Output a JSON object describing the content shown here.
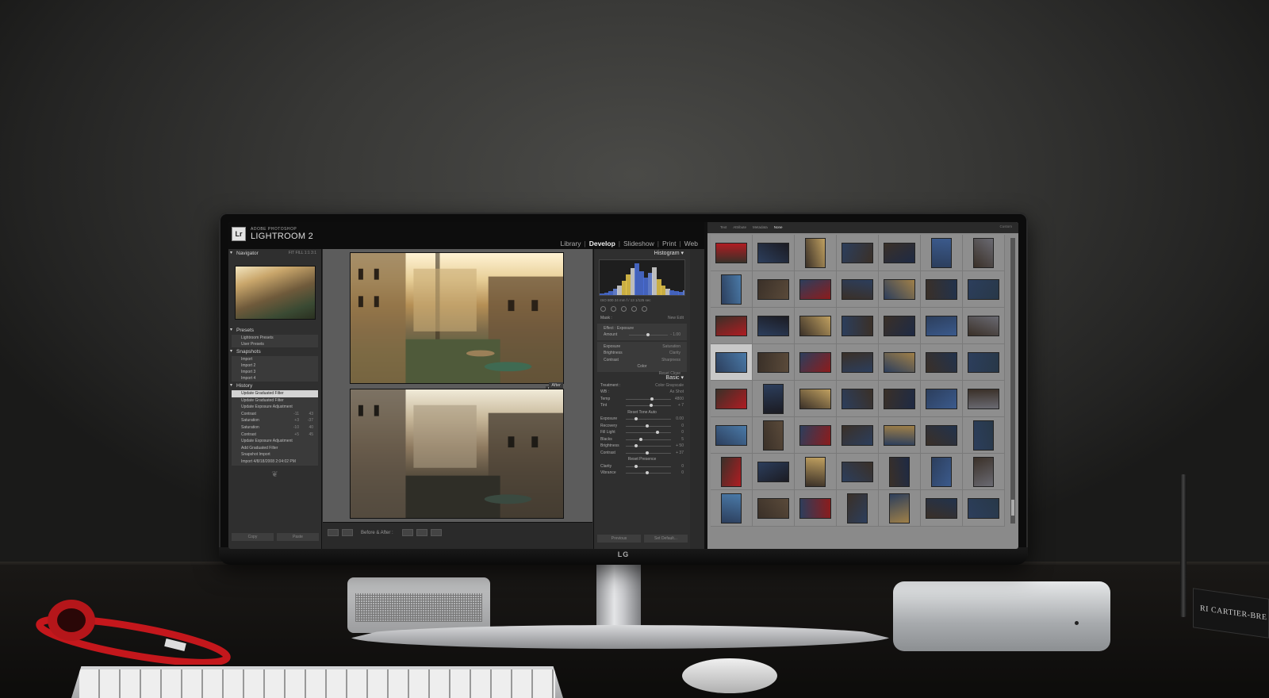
{
  "app": {
    "product_line": "ADOBE PHOTOSHOP",
    "name": "LIGHTROOM 2",
    "logo_text": "Lr"
  },
  "modules": [
    {
      "label": "Library",
      "active": false
    },
    {
      "label": "Develop",
      "active": true
    },
    {
      "label": "Slideshow",
      "active": false
    },
    {
      "label": "Print",
      "active": false
    },
    {
      "label": "Web",
      "active": false
    }
  ],
  "left_panel": {
    "navigator": {
      "title": "Navigator",
      "zoom_options": "FIT  FILL  1:1  3:1"
    },
    "presets": {
      "title": "Presets",
      "items": [
        "Lightroom Presets",
        "User Presets"
      ]
    },
    "snapshots": {
      "title": "Snapshots",
      "items": [
        "Import",
        "Import 2",
        "Import 3",
        "Import 4"
      ]
    },
    "history": {
      "title": "History",
      "items": [
        {
          "label": "Update Graduated Filter",
          "v1": "",
          "v2": "",
          "selected": true
        },
        {
          "label": "Update Graduated Filter",
          "v1": "",
          "v2": "",
          "selected": false
        },
        {
          "label": "Update Exposure Adjustment",
          "v1": "",
          "v2": "",
          "selected": false
        },
        {
          "label": "Contrast",
          "v1": "-11",
          "v2": "43",
          "selected": false
        },
        {
          "label": "Saturation",
          "v1": "+3",
          "v2": "-37",
          "selected": false
        },
        {
          "label": "Saturation",
          "v1": "-10",
          "v2": "40",
          "selected": false
        },
        {
          "label": "Contrast",
          "v1": "+5",
          "v2": "45",
          "selected": false
        },
        {
          "label": "Update Exposure Adjustment",
          "v1": "",
          "v2": "",
          "selected": false
        },
        {
          "label": "Add Graduated Filter",
          "v1": "",
          "v2": "",
          "selected": false
        },
        {
          "label": "Snapshot Import",
          "v1": "",
          "v2": "",
          "selected": false
        },
        {
          "label": "Import 4/8/18/2008 2:04:02 PM",
          "v1": "",
          "v2": "",
          "selected": false
        }
      ]
    },
    "buttons": {
      "copy": "Copy",
      "paste": "Paste"
    }
  },
  "center": {
    "before_label": "Before",
    "after_label": "After",
    "toolbar_text": "Before & After :"
  },
  "right_panel": {
    "histogram_title": "Histogram",
    "hist_info": "ISO 800   24 mm   f / 13   1/125 sec",
    "mask": {
      "label": "Mask :",
      "new": "New",
      "edit": "Edit"
    },
    "effect": {
      "label": "Effect :",
      "value": "Exposure",
      "amount_label": "Amount",
      "amount_value": "- 1.00"
    },
    "adjust_rows": [
      {
        "left": "Exposure",
        "right": "Saturation"
      },
      {
        "left": "Brightness",
        "right": "Clarity"
      },
      {
        "left": "Contrast",
        "right": "Sharpness"
      }
    ],
    "color_label": "Color",
    "reset_label": "Reset",
    "close_label": "Close",
    "basic_title": "Basic",
    "treatment": {
      "label": "Treatment :",
      "color": "Color",
      "grayscale": "Grayscale"
    },
    "wb": {
      "label": "WB :",
      "value": "As Shot"
    },
    "temp": {
      "label": "Temp",
      "value": "4800"
    },
    "tint": {
      "label": "Tint",
      "value": "+ 7"
    },
    "tone_label": "Reset Tone",
    "auto_label": "Auto",
    "tone_rows": [
      {
        "label": "Exposure",
        "value": "0.00"
      },
      {
        "label": "Recovery",
        "value": "0"
      },
      {
        "label": "Fill Light",
        "value": "0"
      },
      {
        "label": "Blacks",
        "value": "5"
      }
    ],
    "bc_rows": [
      {
        "label": "Brightness",
        "value": "+ 50"
      },
      {
        "label": "Contrast",
        "value": "+ 37"
      }
    ],
    "presence_label": "Reset Presence",
    "presence_rows": [
      {
        "label": "Clarity",
        "value": "0"
      },
      {
        "label": "Vibrance",
        "value": "0"
      }
    ],
    "footer": {
      "previous": "Previous",
      "set_default": "Set Default..."
    }
  },
  "grid_window": {
    "tabs": [
      "Text",
      "Attribute",
      "Metadata",
      "None"
    ],
    "active_tab": "None",
    "window_label": "Custom"
  },
  "chin_logo": "LG",
  "book_text": "RI CARTIER-BRE"
}
